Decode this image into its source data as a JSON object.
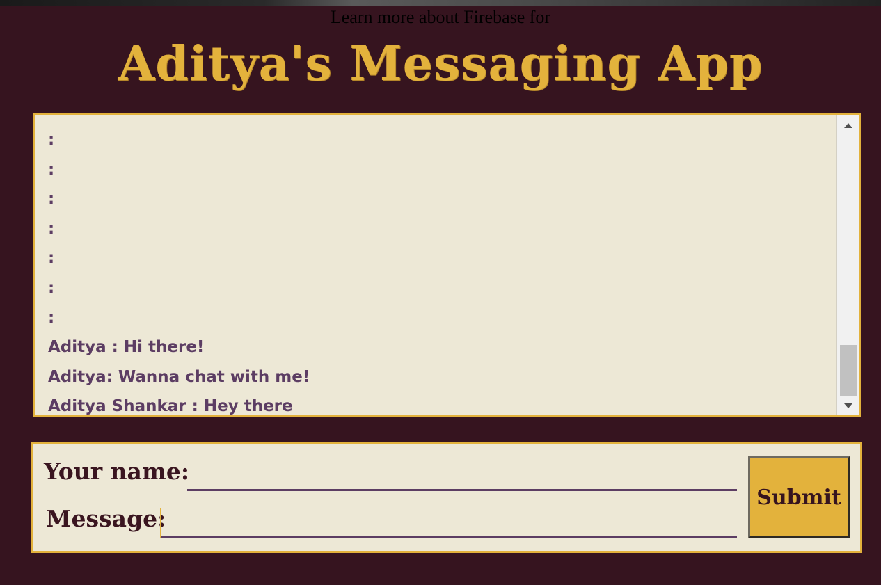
{
  "header": {
    "firebase_link": "Learn more about Firebase for",
    "title": "Aditya's Messaging App"
  },
  "messages": [
    ":",
    ":",
    ":",
    ":",
    ":",
    ":",
    ":",
    "Aditya : Hi there!",
    "Aditya: Wanna chat with me!",
    "Aditya Shankar : Hey there"
  ],
  "form": {
    "name_label": "Your name:",
    "name_value": "",
    "message_label": "Message:",
    "message_value": "",
    "submit_label": "Submit"
  },
  "icons": {
    "scroll_up": "triangle-up-icon",
    "scroll_down": "triangle-down-icon"
  },
  "colors": {
    "background": "#36141f",
    "accent": "#e3b23c",
    "panel": "#ede8d6",
    "message_text": "#5c3d63"
  }
}
